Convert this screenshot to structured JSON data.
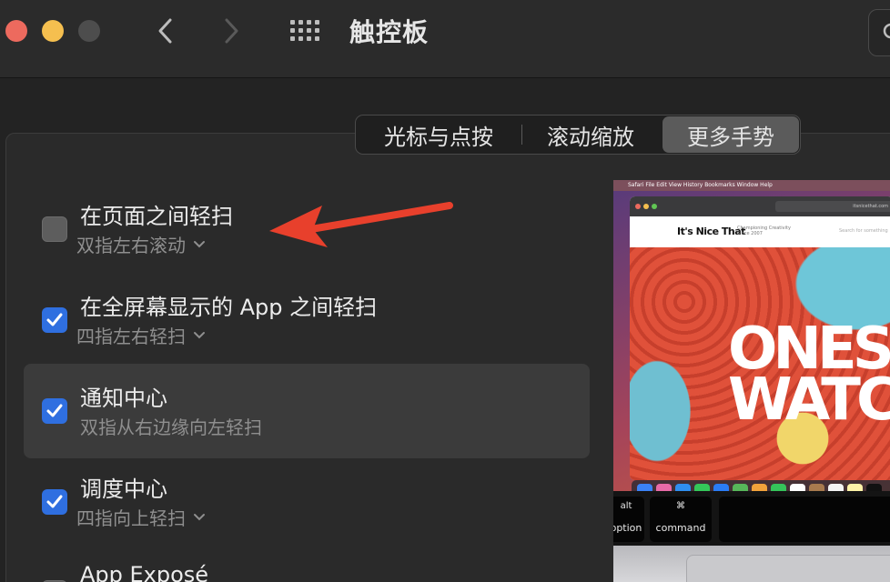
{
  "window": {
    "title": "触控板"
  },
  "tabs": [
    {
      "label": "光标与点按",
      "selected": false
    },
    {
      "label": "滚动缩放",
      "selected": false
    },
    {
      "label": "更多手势",
      "selected": true
    }
  ],
  "options": [
    {
      "title": "在页面之间轻扫",
      "subtitle": "双指左右滚动",
      "checked": false,
      "has_menu": true
    },
    {
      "title": "在全屏幕显示的 App 之间轻扫",
      "subtitle": "四指左右轻扫",
      "checked": true,
      "has_menu": true
    },
    {
      "title": "通知中心",
      "subtitle": "双指从右边缘向左轻扫",
      "checked": true,
      "has_menu": false,
      "highlighted": true
    },
    {
      "title": "调度中心",
      "subtitle": "四指向上轻扫",
      "checked": true,
      "has_menu": true
    },
    {
      "title": "App Exposé",
      "subtitle": "",
      "checked": false,
      "has_menu": false
    }
  ],
  "preview": {
    "menubar": "Safari  File  Edit  View  History  Bookmarks  Window  Help",
    "url": "itsnicethat.com",
    "site_logo": "It's Nice That",
    "site_tagline": "Championing Creativity Since 2007",
    "site_search": "Search for something",
    "hero_text": "ONES WATC",
    "keys": [
      {
        "top": "alt",
        "bottom": "option"
      },
      {
        "top": "⌘",
        "bottom": "command"
      }
    ]
  },
  "colors": {
    "accent": "#2f6fe0",
    "annotation_arrow": "#e8402c",
    "close": "#ed6a5e",
    "minimize": "#f5bf4f"
  }
}
